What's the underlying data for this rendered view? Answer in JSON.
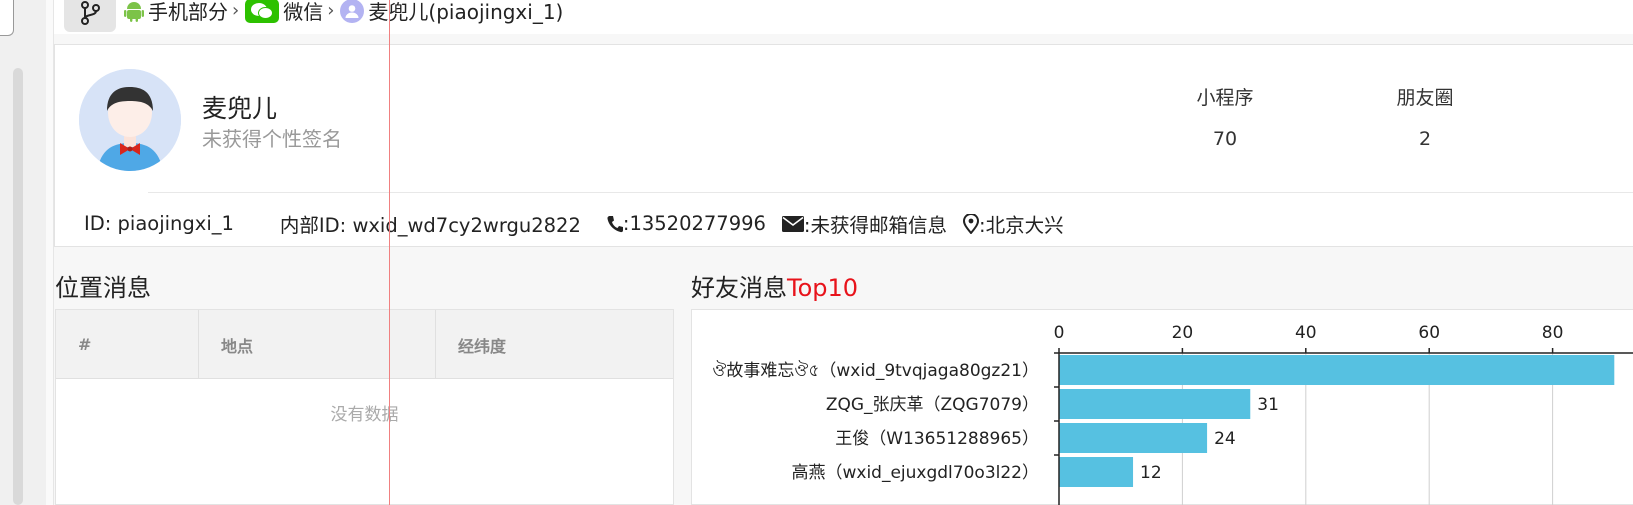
{
  "breadcrumb": {
    "items": [
      {
        "label": "手机部分",
        "icon": "android-icon"
      },
      {
        "label": "微信",
        "icon": "wechat-icon"
      },
      {
        "label": "麦兜儿(piaojingxi_1)",
        "icon": "person-icon"
      }
    ],
    "separator": "›"
  },
  "profile": {
    "name": "麦兜儿",
    "signature": "未获得个性签名",
    "stats": [
      {
        "label": "小程序",
        "value": "70"
      },
      {
        "label": "朋友圈",
        "value": "2"
      }
    ],
    "id_text": "ID: piaojingxi_1",
    "internal_id_text": "内部ID: wxid_wd7cy2wrgu2822",
    "phone_text": ":13520277996",
    "email_text": ":未获得邮箱信息",
    "location_text": ":北京大兴"
  },
  "location_section": {
    "title": "位置消息",
    "columns": [
      "#",
      "地点",
      "经纬度"
    ],
    "empty_text": "没有数据"
  },
  "friends_section": {
    "title": "好友消息",
    "title_accent": "Top10"
  },
  "chart_data": {
    "type": "bar",
    "orientation": "horizontal",
    "categories": [
      "ঔ故事难忘ঔ৫（wxid_9tvqjaga80gz21）",
      "ZQG_张庆革（ZQG7079）",
      "王俊（W13651288965）",
      "高燕（wxid_ejuxgdl70o3l22）"
    ],
    "values": [
      90,
      31,
      24,
      12
    ],
    "value_labels": [
      "",
      "31",
      "24",
      "12"
    ],
    "x_ticks": [
      0,
      20,
      40,
      60,
      80
    ],
    "xlim": [
      0,
      90
    ],
    "axis_position": "top",
    "grid": true,
    "bar_color": "#56c1e1"
  },
  "colors": {
    "accent_red": "#e8131b",
    "wechat_green": "#2dc100",
    "android_green": "#7cc348",
    "bar": "#56c1e1"
  }
}
